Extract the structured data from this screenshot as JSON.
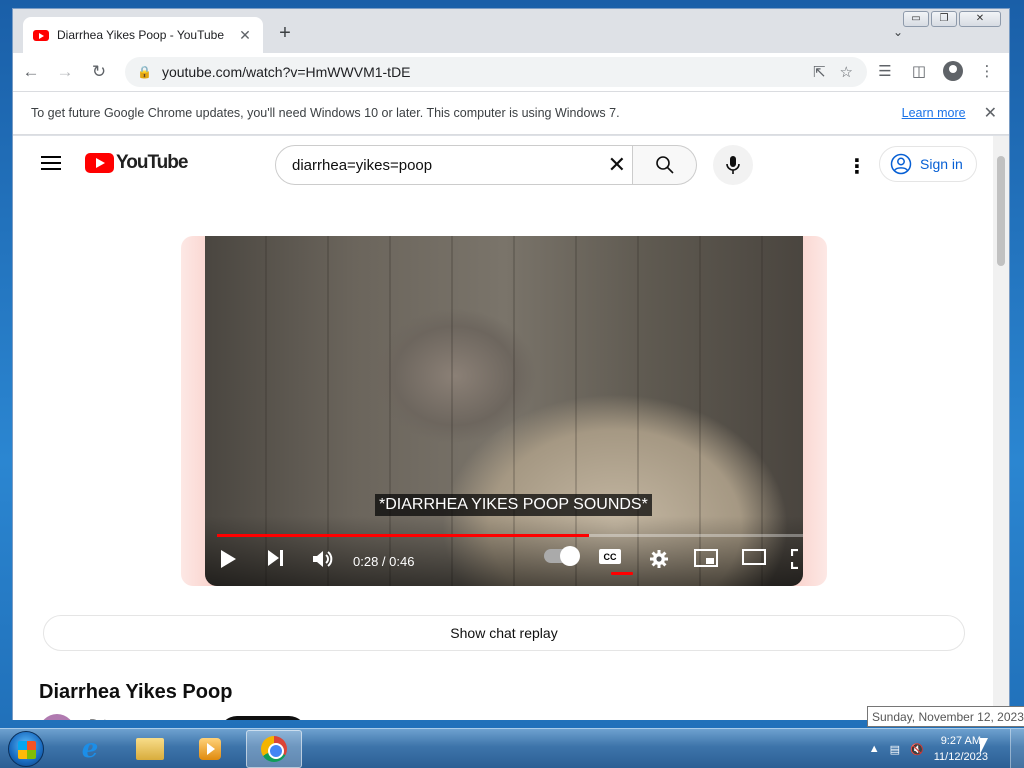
{
  "browser": {
    "tab_title": "Diarrhea Yikes Poop - YouTube",
    "tab_close": "✕",
    "new_tab": "+",
    "tab_search": "⌄",
    "url": "youtube.com/watch?v=HmWWVM1-tDE",
    "window_controls": [
      "▭",
      "❐",
      "✕"
    ]
  },
  "infobar": {
    "message": "To get future Google Chrome updates, you'll need Windows 10 or later. This computer is using Windows 7.",
    "learn_more": "Learn more",
    "close": "✕"
  },
  "youtube": {
    "logo_text": "YouTube",
    "search_query": "diarrhea=yikes=poop",
    "clear": "✕",
    "sign_in": "Sign in",
    "kebab": "⋮"
  },
  "player": {
    "caption": "*DIARRHEA YIKES POOP SOUNDS*",
    "time": "0:28 / 0:46",
    "progress_fraction": 0.61,
    "cc": "CC"
  },
  "page": {
    "show_chat_replay": "Show chat replay",
    "video_title": "Diarrhea Yikes Poop",
    "channel_peek": "D   t"
  },
  "taskbar": {
    "clock_time": "9:27 AM",
    "clock_date": "11/12/2023",
    "tooltip": "Sunday, November 12, 2023",
    "ie_glyph": "e"
  },
  "colors": {
    "yt_red": "#ff0000",
    "link_blue": "#065fd4",
    "chrome_link": "#1a73e8"
  }
}
